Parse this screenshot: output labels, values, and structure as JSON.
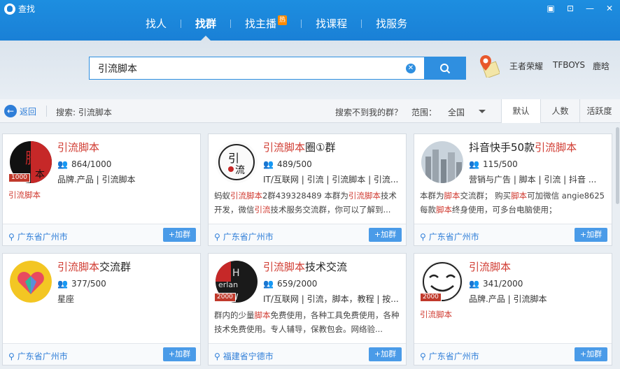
{
  "window": {
    "title": "查找"
  },
  "tabs": [
    {
      "label": "找人"
    },
    {
      "label": "找群"
    },
    {
      "label": "找主播",
      "badge": "热"
    },
    {
      "label": "找课程"
    },
    {
      "label": "找服务"
    }
  ],
  "search": {
    "value": "引流脚本",
    "hot_keywords": [
      "王者荣耀",
      "TFBOYS",
      "鹿晗"
    ]
  },
  "filter": {
    "back": "返回",
    "crumb": "搜索: 引流脚本",
    "notfound": "搜索不到我的群？",
    "range_label": "范围：",
    "range_value": "全国",
    "sort": [
      "默认",
      "人数",
      "活跃度"
    ]
  },
  "cards": [
    {
      "name_hl": "引流脚本",
      "name_rest": "",
      "count": "864/1000",
      "tags": "品牌.产品  |  引流脚本",
      "desc": "",
      "desc_red": "引流脚本",
      "location": "广东省广州市",
      "join": "+加群",
      "level": "1000"
    },
    {
      "name_hl": "引流脚本",
      "name_rest": "圈①群",
      "count": "489/500",
      "tags": "IT/互联网  |  引流  |  引流脚本  |  引流...",
      "desc_parts": [
        "蚂蚁",
        "引流脚本",
        "2群439328489 本群为",
        "引流脚本",
        "技术开发，微信",
        "引流",
        "技术服务交流群，你可以了解到..."
      ],
      "location": "广东省广州市",
      "join": "+加群",
      "level": ""
    },
    {
      "name_hl": "引流脚本",
      "name_pre": "抖音快手50款",
      "name_rest": "",
      "count": "115/500",
      "tags": "营销与广告  |  脚本  |  引流  |  抖音  ...",
      "desc_parts": [
        "本群为",
        "脚本",
        "交流群； 购买",
        "脚本",
        "可加微信 angie8625 每款",
        "脚本",
        "终身使用，可多台电脑使用；"
      ],
      "location": "广东省广州市",
      "join": "+加群",
      "level": ""
    },
    {
      "name_hl": "引流脚本",
      "name_rest": "交流群",
      "count": "377/500",
      "tags": "星座",
      "desc": "",
      "location": "广东省广州市",
      "join": "+加群",
      "level": ""
    },
    {
      "name_hl": "引流脚本",
      "name_rest": "技术交流",
      "count": "659/2000",
      "tags": "IT/互联网  |  引流，脚本，教程  |  按...",
      "desc_parts": [
        "群内的少量",
        "脚本",
        "免费使用，各种工具免费使用，各种技术免费使用。专人辅导，保教包会。网络验..."
      ],
      "location": "福建省宁德市",
      "join": "+加群",
      "level": "2000"
    },
    {
      "name_hl": "引流脚本",
      "name_rest": "",
      "count": "341/2000",
      "tags": "品牌.产品  |  引流脚本",
      "desc": "",
      "desc_red": "引流脚本",
      "location": "广东省广州市",
      "join": "+加群",
      "level": "2000"
    }
  ],
  "colors": {
    "primary": "#1a80d6",
    "highlight": "#d03a30",
    "link": "#2f7ed8"
  }
}
